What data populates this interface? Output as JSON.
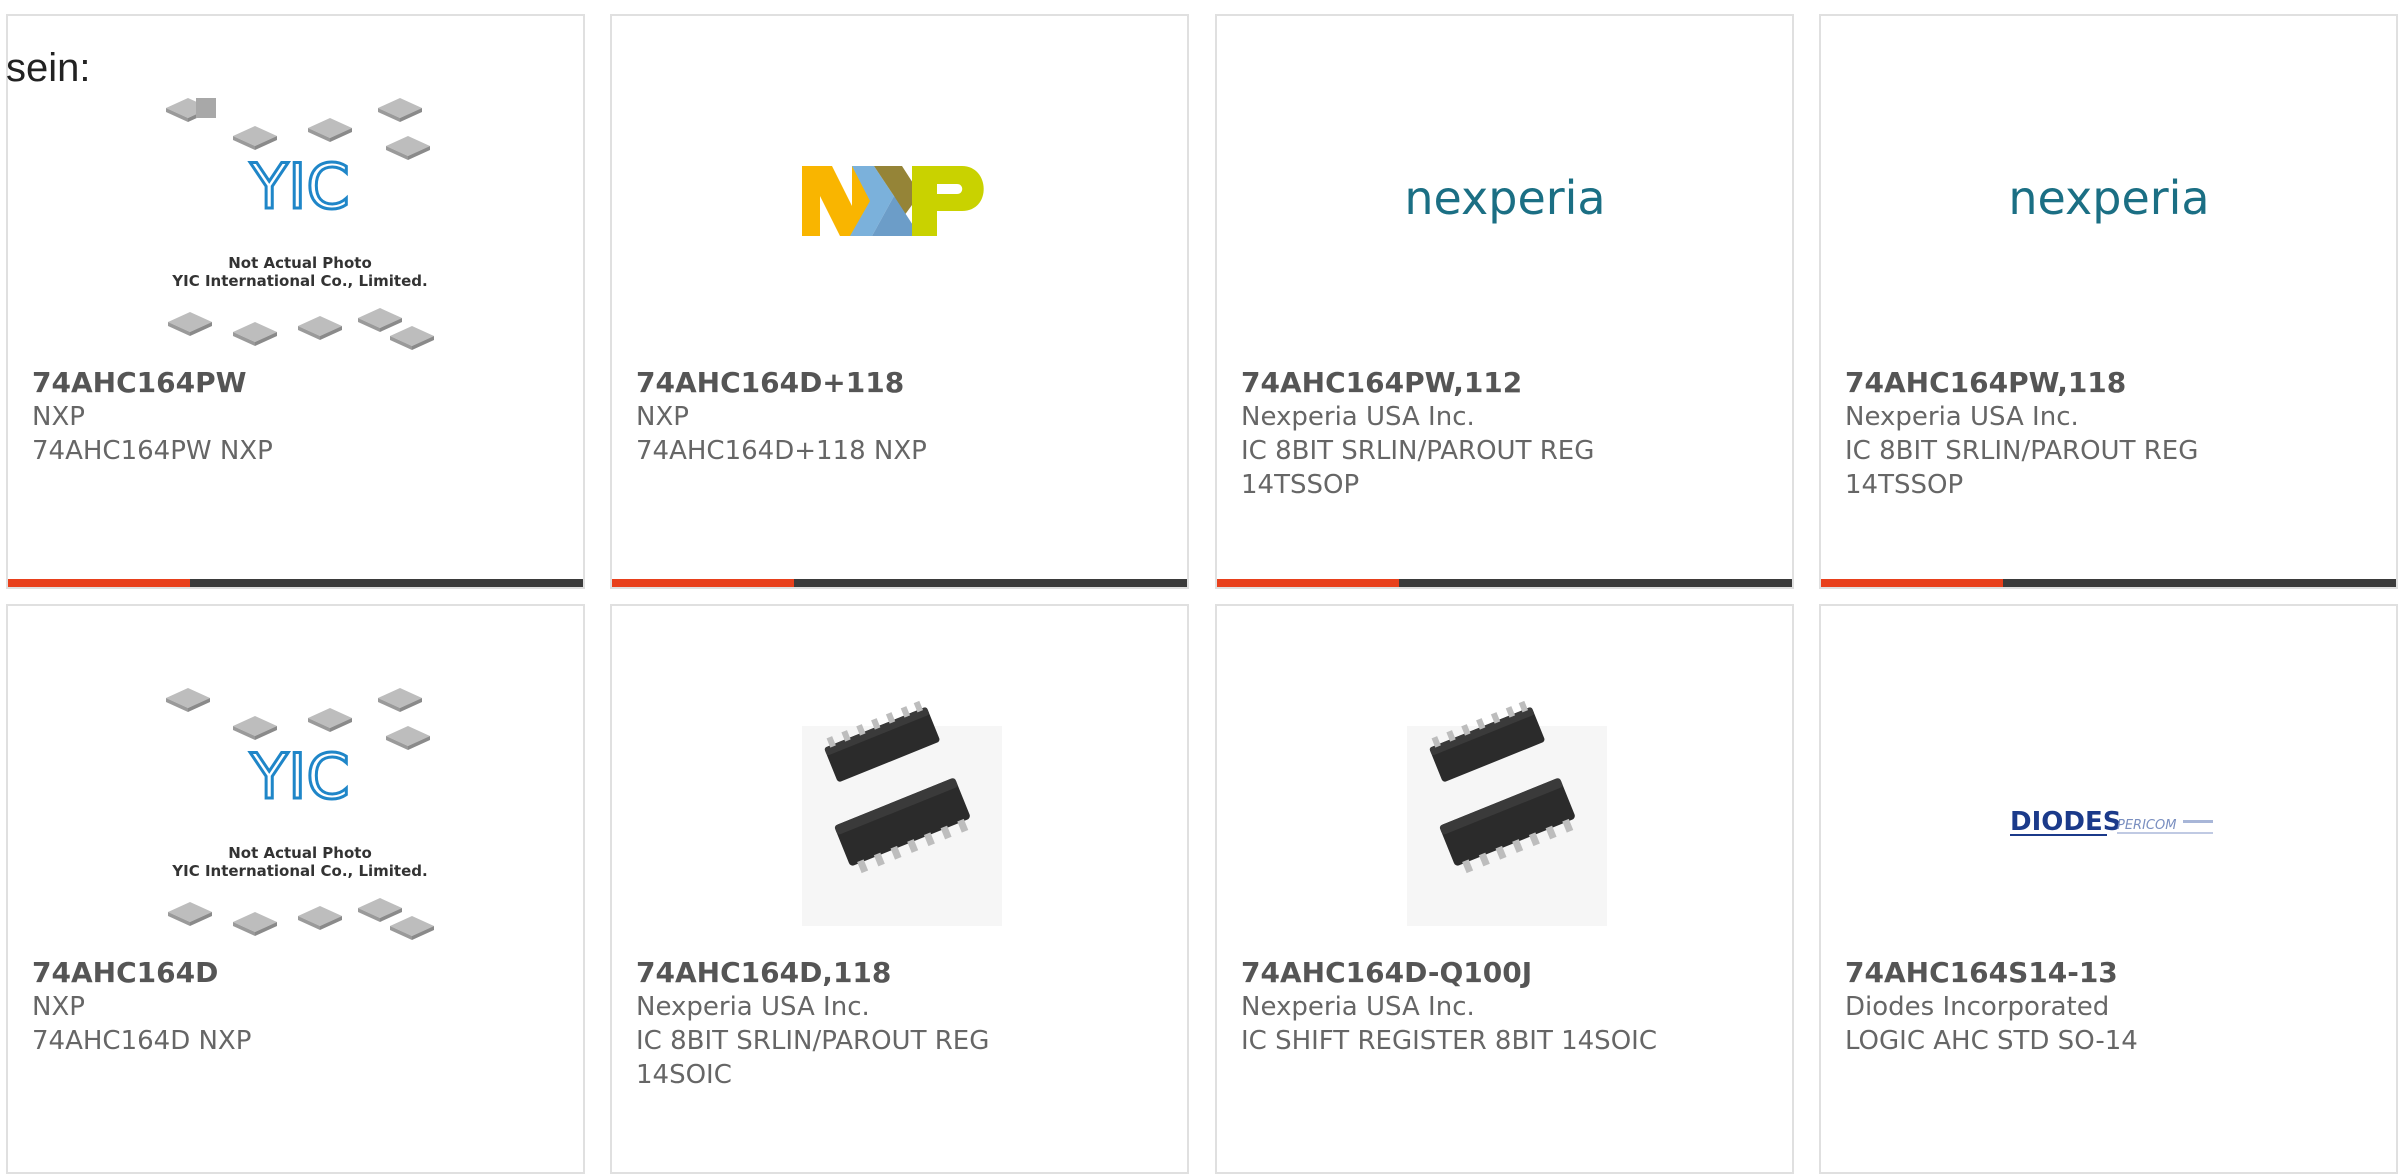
{
  "intro_text": "sein:",
  "colors": {
    "accent": "#e8401c",
    "bar": "#3b3b3b",
    "title": "#555555",
    "body": "#666666",
    "border": "#e0e0e0"
  },
  "placeholder_image": {
    "line1": "Not Actual Photo",
    "line2": "YIC International Co., Limited."
  },
  "products": [
    {
      "part_number": "74AHC164PW",
      "manufacturer": "NXP",
      "description_lines": [
        "74AHC164PW NXP"
      ],
      "image": "yic-placeholder"
    },
    {
      "part_number": "74AHC164D+118",
      "manufacturer": "NXP",
      "description_lines": [
        "74AHC164D+118 NXP"
      ],
      "image": "nxp-logo"
    },
    {
      "part_number": "74AHC164PW,112",
      "manufacturer": "Nexperia USA Inc.",
      "description_lines": [
        "IC 8BIT SRLIN/PAROUT REG",
        "14TSSOP"
      ],
      "image": "nexperia-logo"
    },
    {
      "part_number": "74AHC164PW,118",
      "manufacturer": "Nexperia USA Inc.",
      "description_lines": [
        "IC 8BIT SRLIN/PAROUT REG",
        "14TSSOP"
      ],
      "image": "nexperia-logo"
    },
    {
      "part_number": "74AHC164D",
      "manufacturer": "NXP",
      "description_lines": [
        "74AHC164D NXP"
      ],
      "image": "yic-placeholder"
    },
    {
      "part_number": "74AHC164D,118",
      "manufacturer": "Nexperia USA Inc.",
      "description_lines": [
        "IC 8BIT SRLIN/PAROUT REG",
        "14SOIC"
      ],
      "image": "soic-chip-photo"
    },
    {
      "part_number": "74AHC164D-Q100J",
      "manufacturer": "Nexperia USA Inc.",
      "description_lines": [
        "IC SHIFT REGISTER 8BIT 14SOIC"
      ],
      "image": "soic-chip-photo"
    },
    {
      "part_number": "74AHC164S14-13",
      "manufacturer": "Diodes Incorporated",
      "description_lines": [
        "LOGIC AHC STD SO-14"
      ],
      "image": "diodes-pericom-logo"
    }
  ],
  "logos": {
    "nxp": "NXP",
    "nexperia": "nexperia",
    "diodes": "DIODES",
    "pericom": "PERICOM"
  }
}
